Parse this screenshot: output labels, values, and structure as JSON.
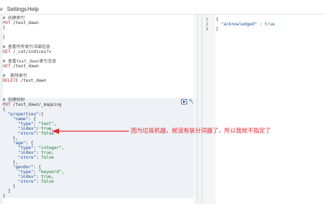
{
  "menubar": {
    "view_partial": "v",
    "settings": "Settings",
    "help": "Help"
  },
  "request_editor": {
    "lines": [
      {
        "kind": "comment",
        "text": "# 创建索引"
      },
      {
        "kind": "request",
        "method": "PUT",
        "path": " /test_dawn"
      },
      {
        "kind": "brace",
        "text": "{"
      },
      {
        "kind": "blank",
        "text": ""
      },
      {
        "kind": "brace",
        "text": "}"
      },
      {
        "kind": "blank",
        "text": ""
      },
      {
        "kind": "comment",
        "text": "# 查看所有索引详细信息"
      },
      {
        "kind": "request",
        "method": "GET",
        "path": " /_cat/indices?v"
      },
      {
        "kind": "blank",
        "text": ""
      },
      {
        "kind": "comment",
        "text": "# 查看test_dawn索引信息"
      },
      {
        "kind": "request",
        "method": "GET",
        "path": " /test_dawn"
      },
      {
        "kind": "blank",
        "text": ""
      },
      {
        "kind": "comment",
        "text": "#  删除索引"
      },
      {
        "kind": "request",
        "method": "DELETE",
        "path": " /test_dawn"
      },
      {
        "kind": "blank",
        "text": ""
      },
      {
        "kind": "blank",
        "text": ""
      },
      {
        "kind": "blank",
        "text": ""
      },
      {
        "kind": "comment",
        "text": "# 创建映射"
      },
      {
        "kind": "request",
        "method": "PUT",
        "path": " /test_dawn/_mapping"
      },
      {
        "kind": "brace",
        "text": "{"
      },
      {
        "kind": "json",
        "indent": "  ",
        "key": "\"properties\"",
        "rest": ":{"
      },
      {
        "kind": "json",
        "indent": "    ",
        "key": "\"name\"",
        "rest": ": {"
      },
      {
        "kind": "json",
        "indent": "      ",
        "key": "\"type\"",
        "rest": ": ",
        "value": "\"text\"",
        "tail": ","
      },
      {
        "kind": "json",
        "indent": "      ",
        "key": "\"index\"",
        "rest": ": ",
        "value": "true",
        "tail": ","
      },
      {
        "kind": "json",
        "indent": "      ",
        "key": "\"store\"",
        "rest": ": ",
        "value": "false",
        "tail": ""
      },
      {
        "kind": "brace",
        "text": "    },"
      },
      {
        "kind": "json",
        "indent": "    ",
        "key": "\"age\"",
        "rest": ": {"
      },
      {
        "kind": "json",
        "indent": "      ",
        "key": "\"type\"",
        "rest": ": ",
        "value": "\"integer\"",
        "tail": ","
      },
      {
        "kind": "json",
        "indent": "      ",
        "key": "\"index\"",
        "rest": ": ",
        "value": "true",
        "tail": ","
      },
      {
        "kind": "json",
        "indent": "      ",
        "key": "\"store\"",
        "rest": ": ",
        "value": "false",
        "tail": ""
      },
      {
        "kind": "brace",
        "text": "    },"
      },
      {
        "kind": "json",
        "indent": "    ",
        "key": "\"gender\"",
        "rest": ": {"
      },
      {
        "kind": "json",
        "indent": "      ",
        "key": "\"type\"",
        "rest": ": ",
        "value": "\"keyword\"",
        "tail": ","
      },
      {
        "kind": "json",
        "indent": "      ",
        "key": "\"index\"",
        "rest": ": ",
        "value": "true",
        "tail": ","
      },
      {
        "kind": "json",
        "indent": "      ",
        "key": "\"store\"",
        "rest": ": ",
        "value": "false",
        "tail": ""
      },
      {
        "kind": "brace",
        "text": "    }"
      },
      {
        "kind": "brace",
        "text": "  }"
      },
      {
        "kind": "brace",
        "text": "}"
      }
    ]
  },
  "response_editor": {
    "lines": [
      {
        "num": "1",
        "text": "{"
      },
      {
        "num": "2",
        "text": "  \"acknowledged\" : true"
      },
      {
        "num": "3",
        "text": "}"
      }
    ]
  },
  "annotation": {
    "text": "因为垃圾机器，就没有装分词器了，所以我就不指定了",
    "color": "#e8232a"
  },
  "icons": {
    "run": "play-icon",
    "settings": "wrench-icon"
  }
}
